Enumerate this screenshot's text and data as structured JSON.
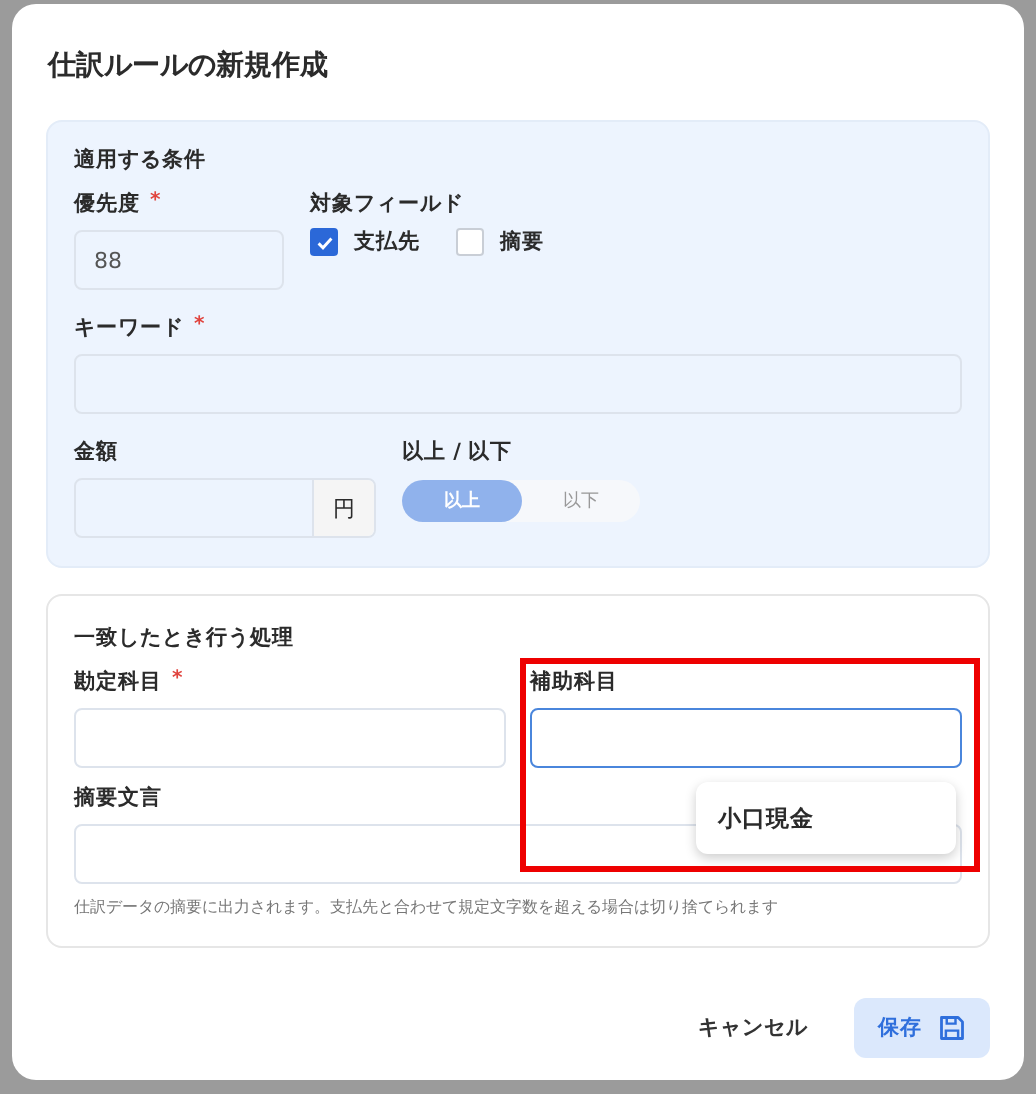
{
  "dialog": {
    "title": "仕訳ルールの新規作成"
  },
  "conditions": {
    "heading": "適用する条件",
    "priority": {
      "label": "優先度",
      "required_mark": "*",
      "value": "88"
    },
    "target_field": {
      "label": "対象フィールド",
      "options": [
        {
          "label": "支払先",
          "checked": true
        },
        {
          "label": "摘要",
          "checked": false
        }
      ]
    },
    "keyword": {
      "label": "キーワード",
      "required_mark": "*"
    },
    "amount": {
      "label": "金額",
      "unit": "円"
    },
    "comparison": {
      "label": "以上 / 以下",
      "options": [
        {
          "label": "以上",
          "selected": true
        },
        {
          "label": "以下",
          "selected": false
        }
      ]
    }
  },
  "actions": {
    "heading": "一致したとき行う処理",
    "account": {
      "label": "勘定科目",
      "required_mark": "*"
    },
    "sub_account": {
      "label": "補助科目",
      "focused": true,
      "suggestions": [
        "小口現金"
      ]
    },
    "summary": {
      "label": "摘要文言",
      "help": "仕訳データの摘要に出力されます。支払先と合わせて規定文字数を超える場合は切り捨てられます"
    }
  },
  "buttons": [
    {
      "label": "キャンセル",
      "kind": "text"
    },
    {
      "label": "保存",
      "kind": "save"
    }
  ]
}
